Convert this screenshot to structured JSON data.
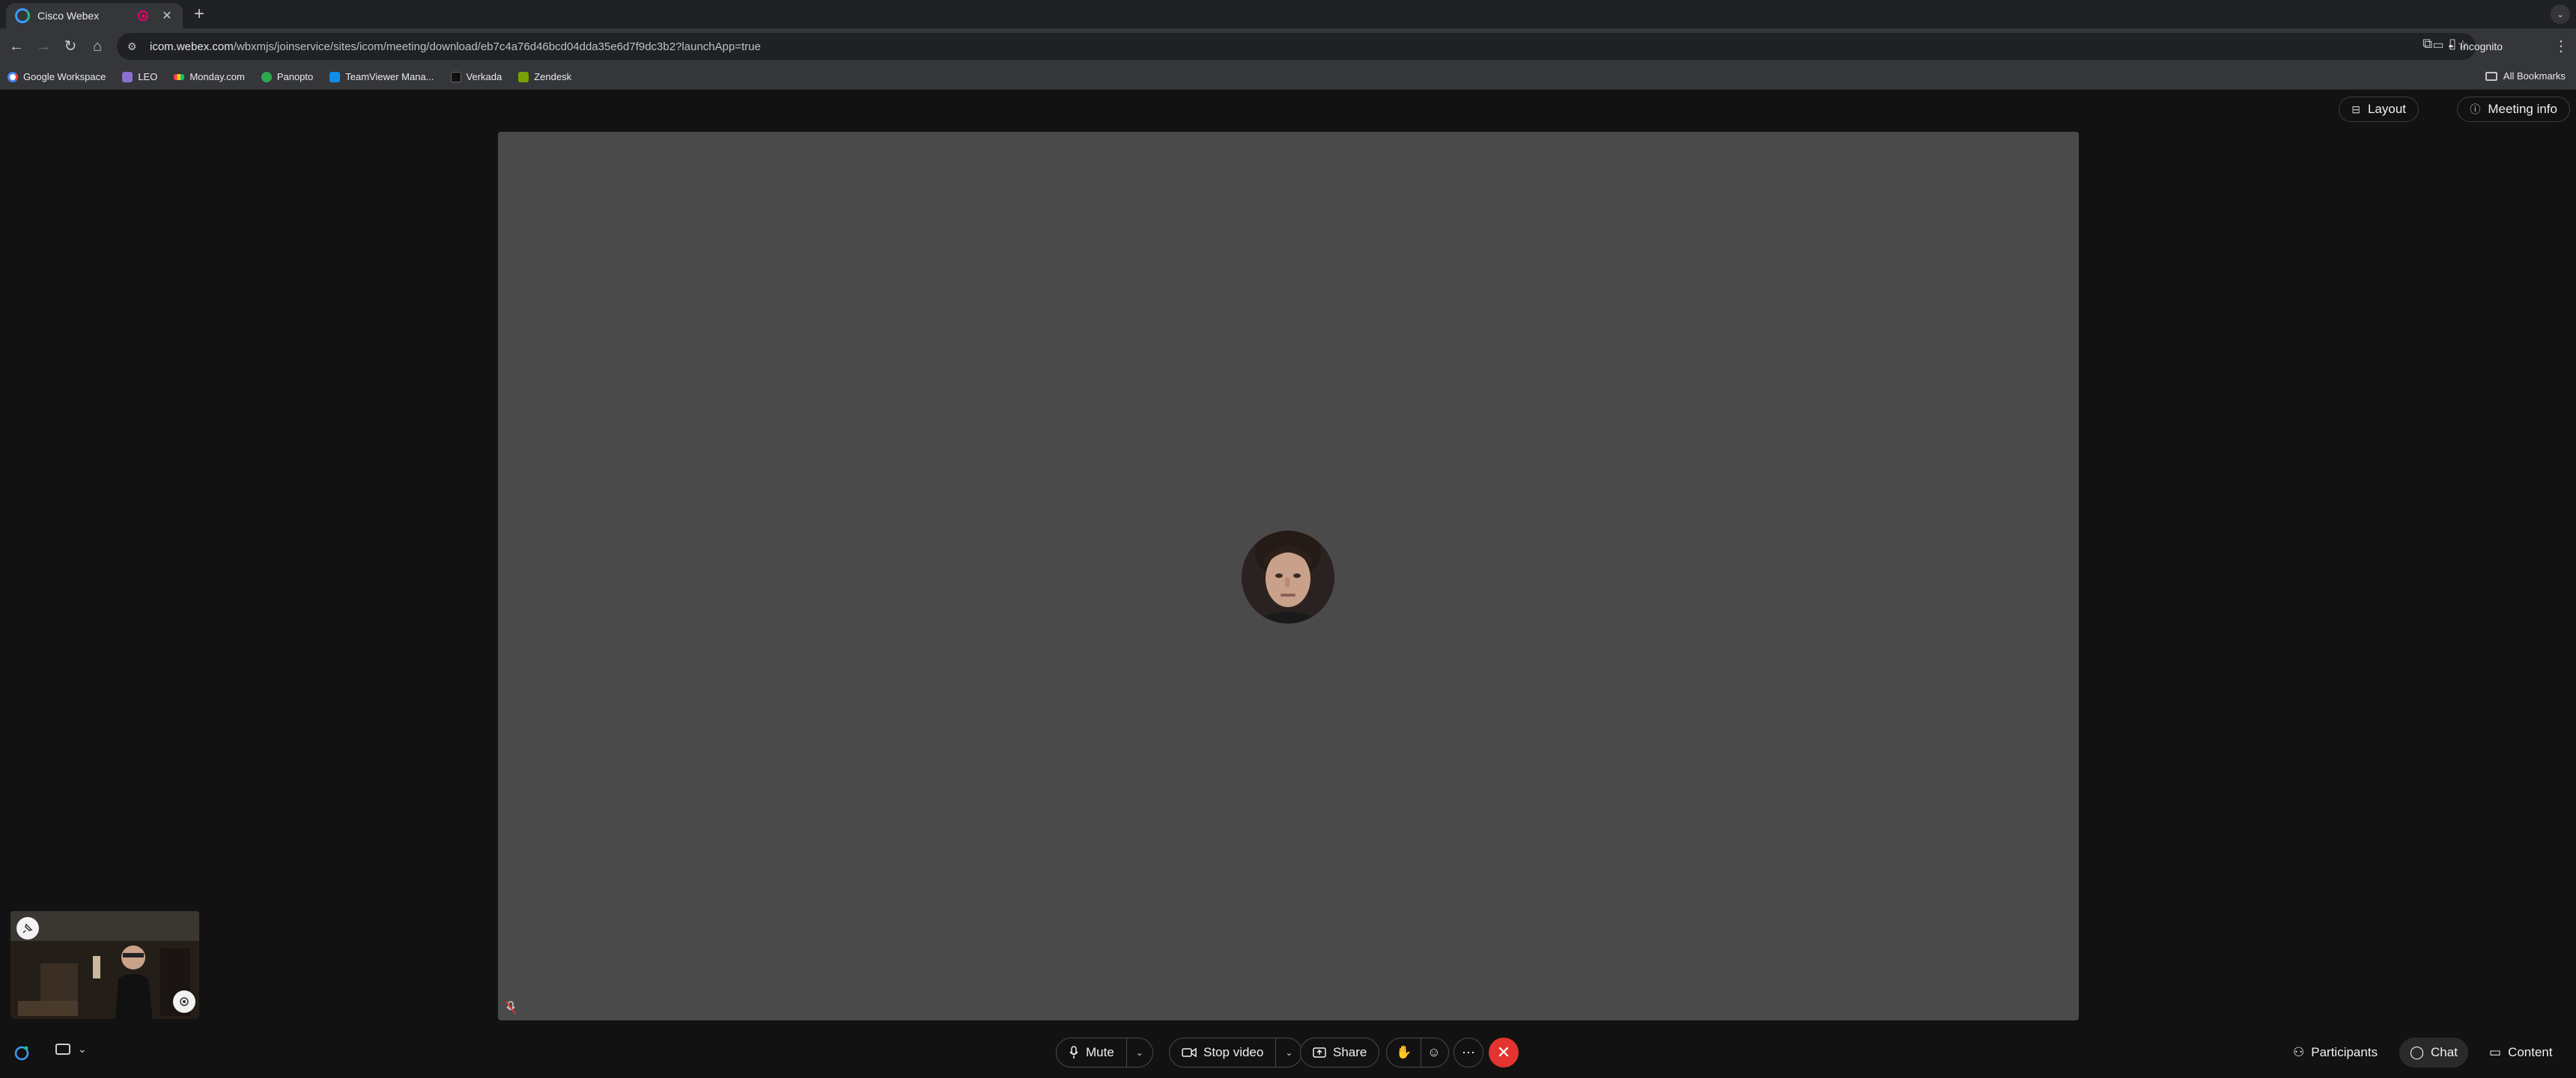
{
  "browser": {
    "tab_title": "Cisco Webex",
    "url_host": "icom.webex.com",
    "url_path": "/wbxmjs/joinservice/sites/icom/meeting/download/eb7c4a76d46bcd04dda35e6d7f9dc3b2?launchApp=true",
    "incognito_label": "Incognito",
    "bookmarks": [
      {
        "label": "Google Workspace",
        "color": "#4285f4"
      },
      {
        "label": "LEO",
        "color": "#8a6fd1"
      },
      {
        "label": "Monday.com",
        "color": "#ff3d57"
      },
      {
        "label": "Panopto",
        "color": "#2fa84f"
      },
      {
        "label": "TeamViewer Mana...",
        "color": "#0e8ee9"
      },
      {
        "label": "Verkada",
        "color": "#111111"
      },
      {
        "label": "Zendesk",
        "color": "#78a300"
      }
    ],
    "all_bookmarks_label": "All Bookmarks"
  },
  "meeting": {
    "layout_label": "Layout",
    "meeting_info_label": "Meeting info",
    "controls": {
      "mute_label": "Mute",
      "stop_video_label": "Stop video",
      "share_label": "Share"
    },
    "panels": {
      "participants_label": "Participants",
      "chat_label": "Chat",
      "content_label": "Content"
    },
    "colors": {
      "end_call": "#e3342f",
      "stage": "#4a4a4a",
      "background": "#121212"
    }
  }
}
